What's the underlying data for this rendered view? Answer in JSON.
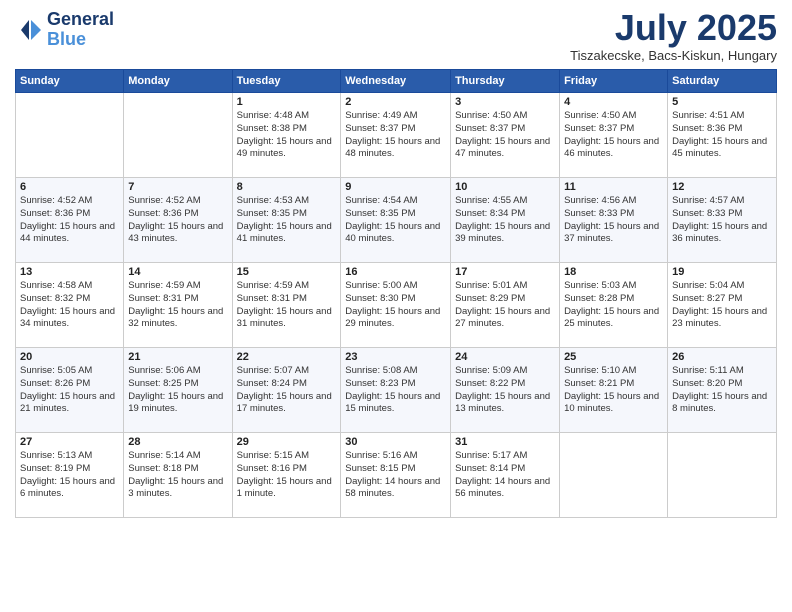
{
  "header": {
    "logo_line1": "General",
    "logo_line2": "Blue",
    "month_year": "July 2025",
    "location": "Tiszakecske, Bacs-Kiskun, Hungary"
  },
  "weekdays": [
    "Sunday",
    "Monday",
    "Tuesday",
    "Wednesday",
    "Thursday",
    "Friday",
    "Saturday"
  ],
  "weeks": [
    [
      {
        "day": "",
        "sunrise": "",
        "sunset": "",
        "daylight": ""
      },
      {
        "day": "",
        "sunrise": "",
        "sunset": "",
        "daylight": ""
      },
      {
        "day": "1",
        "sunrise": "Sunrise: 4:48 AM",
        "sunset": "Sunset: 8:38 PM",
        "daylight": "Daylight: 15 hours and 49 minutes."
      },
      {
        "day": "2",
        "sunrise": "Sunrise: 4:49 AM",
        "sunset": "Sunset: 8:37 PM",
        "daylight": "Daylight: 15 hours and 48 minutes."
      },
      {
        "day": "3",
        "sunrise": "Sunrise: 4:50 AM",
        "sunset": "Sunset: 8:37 PM",
        "daylight": "Daylight: 15 hours and 47 minutes."
      },
      {
        "day": "4",
        "sunrise": "Sunrise: 4:50 AM",
        "sunset": "Sunset: 8:37 PM",
        "daylight": "Daylight: 15 hours and 46 minutes."
      },
      {
        "day": "5",
        "sunrise": "Sunrise: 4:51 AM",
        "sunset": "Sunset: 8:36 PM",
        "daylight": "Daylight: 15 hours and 45 minutes."
      }
    ],
    [
      {
        "day": "6",
        "sunrise": "Sunrise: 4:52 AM",
        "sunset": "Sunset: 8:36 PM",
        "daylight": "Daylight: 15 hours and 44 minutes."
      },
      {
        "day": "7",
        "sunrise": "Sunrise: 4:52 AM",
        "sunset": "Sunset: 8:36 PM",
        "daylight": "Daylight: 15 hours and 43 minutes."
      },
      {
        "day": "8",
        "sunrise": "Sunrise: 4:53 AM",
        "sunset": "Sunset: 8:35 PM",
        "daylight": "Daylight: 15 hours and 41 minutes."
      },
      {
        "day": "9",
        "sunrise": "Sunrise: 4:54 AM",
        "sunset": "Sunset: 8:35 PM",
        "daylight": "Daylight: 15 hours and 40 minutes."
      },
      {
        "day": "10",
        "sunrise": "Sunrise: 4:55 AM",
        "sunset": "Sunset: 8:34 PM",
        "daylight": "Daylight: 15 hours and 39 minutes."
      },
      {
        "day": "11",
        "sunrise": "Sunrise: 4:56 AM",
        "sunset": "Sunset: 8:33 PM",
        "daylight": "Daylight: 15 hours and 37 minutes."
      },
      {
        "day": "12",
        "sunrise": "Sunrise: 4:57 AM",
        "sunset": "Sunset: 8:33 PM",
        "daylight": "Daylight: 15 hours and 36 minutes."
      }
    ],
    [
      {
        "day": "13",
        "sunrise": "Sunrise: 4:58 AM",
        "sunset": "Sunset: 8:32 PM",
        "daylight": "Daylight: 15 hours and 34 minutes."
      },
      {
        "day": "14",
        "sunrise": "Sunrise: 4:59 AM",
        "sunset": "Sunset: 8:31 PM",
        "daylight": "Daylight: 15 hours and 32 minutes."
      },
      {
        "day": "15",
        "sunrise": "Sunrise: 4:59 AM",
        "sunset": "Sunset: 8:31 PM",
        "daylight": "Daylight: 15 hours and 31 minutes."
      },
      {
        "day": "16",
        "sunrise": "Sunrise: 5:00 AM",
        "sunset": "Sunset: 8:30 PM",
        "daylight": "Daylight: 15 hours and 29 minutes."
      },
      {
        "day": "17",
        "sunrise": "Sunrise: 5:01 AM",
        "sunset": "Sunset: 8:29 PM",
        "daylight": "Daylight: 15 hours and 27 minutes."
      },
      {
        "day": "18",
        "sunrise": "Sunrise: 5:03 AM",
        "sunset": "Sunset: 8:28 PM",
        "daylight": "Daylight: 15 hours and 25 minutes."
      },
      {
        "day": "19",
        "sunrise": "Sunrise: 5:04 AM",
        "sunset": "Sunset: 8:27 PM",
        "daylight": "Daylight: 15 hours and 23 minutes."
      }
    ],
    [
      {
        "day": "20",
        "sunrise": "Sunrise: 5:05 AM",
        "sunset": "Sunset: 8:26 PM",
        "daylight": "Daylight: 15 hours and 21 minutes."
      },
      {
        "day": "21",
        "sunrise": "Sunrise: 5:06 AM",
        "sunset": "Sunset: 8:25 PM",
        "daylight": "Daylight: 15 hours and 19 minutes."
      },
      {
        "day": "22",
        "sunrise": "Sunrise: 5:07 AM",
        "sunset": "Sunset: 8:24 PM",
        "daylight": "Daylight: 15 hours and 17 minutes."
      },
      {
        "day": "23",
        "sunrise": "Sunrise: 5:08 AM",
        "sunset": "Sunset: 8:23 PM",
        "daylight": "Daylight: 15 hours and 15 minutes."
      },
      {
        "day": "24",
        "sunrise": "Sunrise: 5:09 AM",
        "sunset": "Sunset: 8:22 PM",
        "daylight": "Daylight: 15 hours and 13 minutes."
      },
      {
        "day": "25",
        "sunrise": "Sunrise: 5:10 AM",
        "sunset": "Sunset: 8:21 PM",
        "daylight": "Daylight: 15 hours and 10 minutes."
      },
      {
        "day": "26",
        "sunrise": "Sunrise: 5:11 AM",
        "sunset": "Sunset: 8:20 PM",
        "daylight": "Daylight: 15 hours and 8 minutes."
      }
    ],
    [
      {
        "day": "27",
        "sunrise": "Sunrise: 5:13 AM",
        "sunset": "Sunset: 8:19 PM",
        "daylight": "Daylight: 15 hours and 6 minutes."
      },
      {
        "day": "28",
        "sunrise": "Sunrise: 5:14 AM",
        "sunset": "Sunset: 8:18 PM",
        "daylight": "Daylight: 15 hours and 3 minutes."
      },
      {
        "day": "29",
        "sunrise": "Sunrise: 5:15 AM",
        "sunset": "Sunset: 8:16 PM",
        "daylight": "Daylight: 15 hours and 1 minute."
      },
      {
        "day": "30",
        "sunrise": "Sunrise: 5:16 AM",
        "sunset": "Sunset: 8:15 PM",
        "daylight": "Daylight: 14 hours and 58 minutes."
      },
      {
        "day": "31",
        "sunrise": "Sunrise: 5:17 AM",
        "sunset": "Sunset: 8:14 PM",
        "daylight": "Daylight: 14 hours and 56 minutes."
      },
      {
        "day": "",
        "sunrise": "",
        "sunset": "",
        "daylight": ""
      },
      {
        "day": "",
        "sunrise": "",
        "sunset": "",
        "daylight": ""
      }
    ]
  ]
}
